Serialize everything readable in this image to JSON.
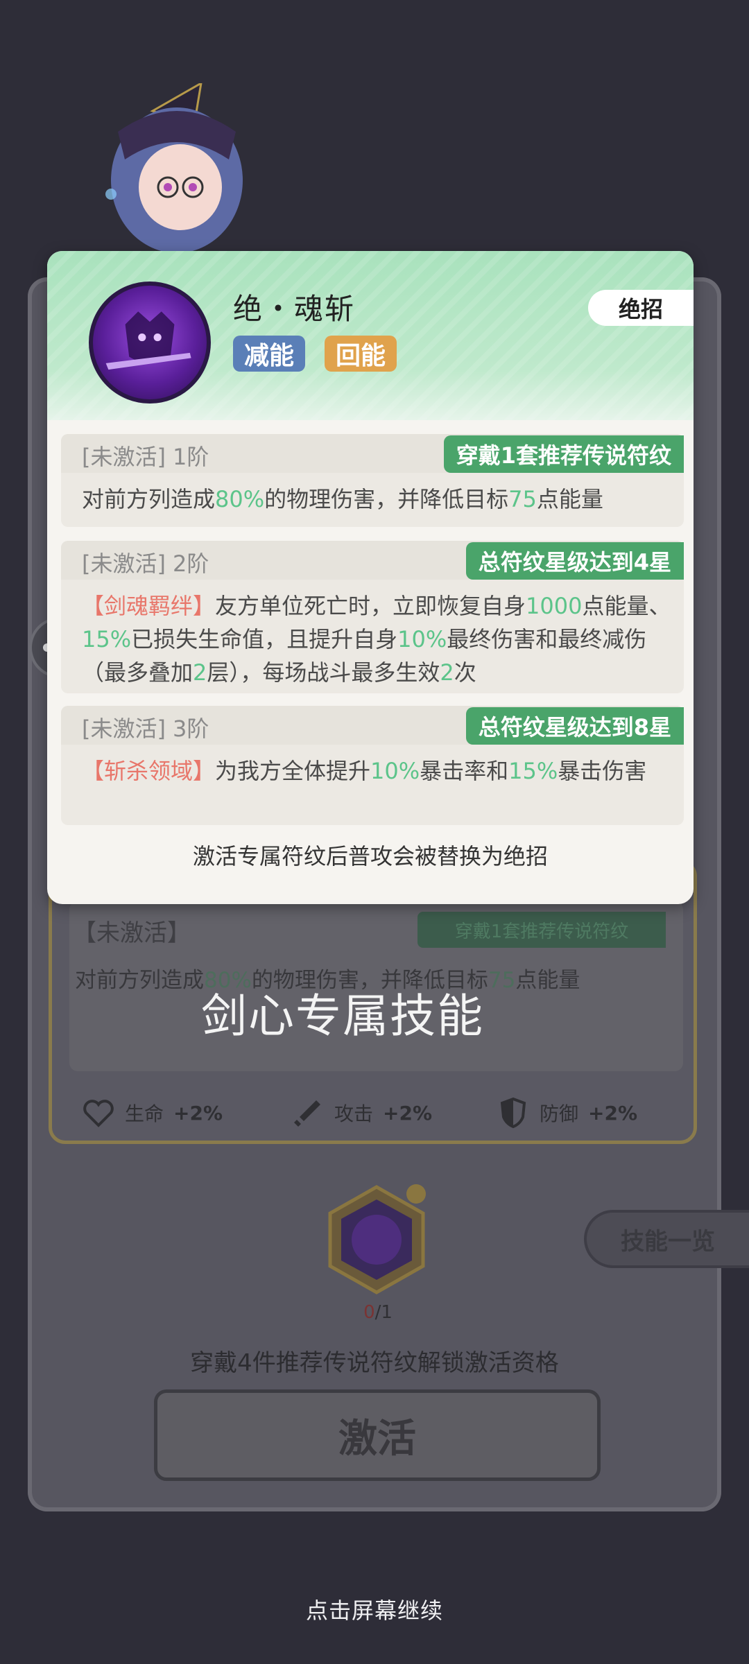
{
  "background": {
    "status": "【未激活】",
    "chip": "穿戴1套推荐传说符纹",
    "desc_parts": [
      "对前方列造成",
      "80%",
      "的物理伤害，并降低目标",
      "75",
      "点能量"
    ]
  },
  "overlay_title": "剑心专属技能",
  "stats": [
    {
      "icon": "heart-icon",
      "label": "生命",
      "value": "+2%"
    },
    {
      "icon": "sword-icon",
      "label": "攻击",
      "value": "+2%"
    },
    {
      "icon": "shield-icon",
      "label": "防御",
      "value": "+2%"
    }
  ],
  "rune": {
    "count_have": "0",
    "count_sep": "/1"
  },
  "unlock_hint": "穿戴4件推荐传说符纹解锁激活资格",
  "activate_label": "激活",
  "skill_list_label": "技能一览",
  "continue_hint": "点击屏幕继续",
  "popup": {
    "skill_name": "绝・魂斩",
    "tags": [
      "减能",
      "回能"
    ],
    "badge": "绝招",
    "tiers": [
      {
        "status": "[未激活]",
        "level": "1阶",
        "requirement": "穿戴1套推荐传说符纹",
        "desc": [
          {
            "t": "对前方列造成",
            "c": ""
          },
          {
            "t": "80%",
            "c": "g"
          },
          {
            "t": "的物理伤害，并降低目标",
            "c": ""
          },
          {
            "t": "75",
            "c": "g"
          },
          {
            "t": "点能量",
            "c": ""
          }
        ]
      },
      {
        "status": "[未激活]",
        "level": "2阶",
        "requirement": "总符纹星级达到4星",
        "desc": [
          {
            "t": "【剑魂羁绊】",
            "c": "red"
          },
          {
            "t": "友方单位死亡时，立即恢复自身",
            "c": ""
          },
          {
            "t": "1000",
            "c": "g"
          },
          {
            "t": "点能量、",
            "c": ""
          },
          {
            "t": "15%",
            "c": "g"
          },
          {
            "t": "已损失生命值，且提升自身",
            "c": ""
          },
          {
            "t": "10%",
            "c": "g"
          },
          {
            "t": "最终伤害和最终减伤（最多叠加",
            "c": ""
          },
          {
            "t": "2",
            "c": "g"
          },
          {
            "t": "层），每场战斗最多生效",
            "c": ""
          },
          {
            "t": "2",
            "c": "g"
          },
          {
            "t": "次",
            "c": ""
          }
        ]
      },
      {
        "status": "[未激活]",
        "level": "3阶",
        "requirement": "总符纹星级达到8星",
        "desc": [
          {
            "t": "【斩杀领域】",
            "c": "red"
          },
          {
            "t": "为我方全体提升",
            "c": ""
          },
          {
            "t": "10%",
            "c": "g"
          },
          {
            "t": "暴击率和",
            "c": ""
          },
          {
            "t": "15%",
            "c": "g"
          },
          {
            "t": "暴击伤害",
            "c": ""
          }
        ]
      }
    ],
    "footer": "激活专属符纹后普攻会被替换为绝招"
  },
  "colors": {
    "accent_green": "#4aa46a",
    "highlight_green": "#5cc48a",
    "highlight_red": "#e8766a"
  }
}
